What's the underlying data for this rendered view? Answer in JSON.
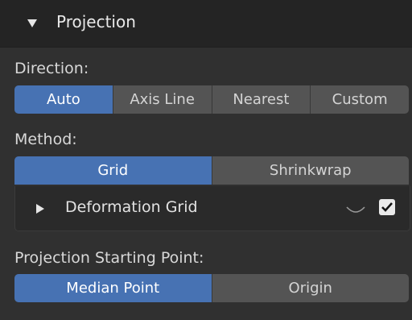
{
  "panel": {
    "title": "Projection"
  },
  "direction": {
    "label": "Direction:",
    "options": [
      "Auto",
      "Axis Line",
      "Nearest",
      "Custom"
    ],
    "selected": "Auto"
  },
  "method": {
    "label": "Method:",
    "options": [
      "Grid",
      "Shrinkwrap"
    ],
    "selected": "Grid"
  },
  "deformation_grid": {
    "label": "Deformation Grid",
    "enabled": true,
    "icons": [
      "expand-arrow-icon",
      "curve-icon",
      "checkbox-icon"
    ]
  },
  "projection_start": {
    "label": "Projection Starting Point:",
    "options": [
      "Median Point",
      "Origin"
    ],
    "selected": "Median Point"
  },
  "colors": {
    "accent": "#4772b3",
    "button": "#545454",
    "background": "#303030"
  }
}
